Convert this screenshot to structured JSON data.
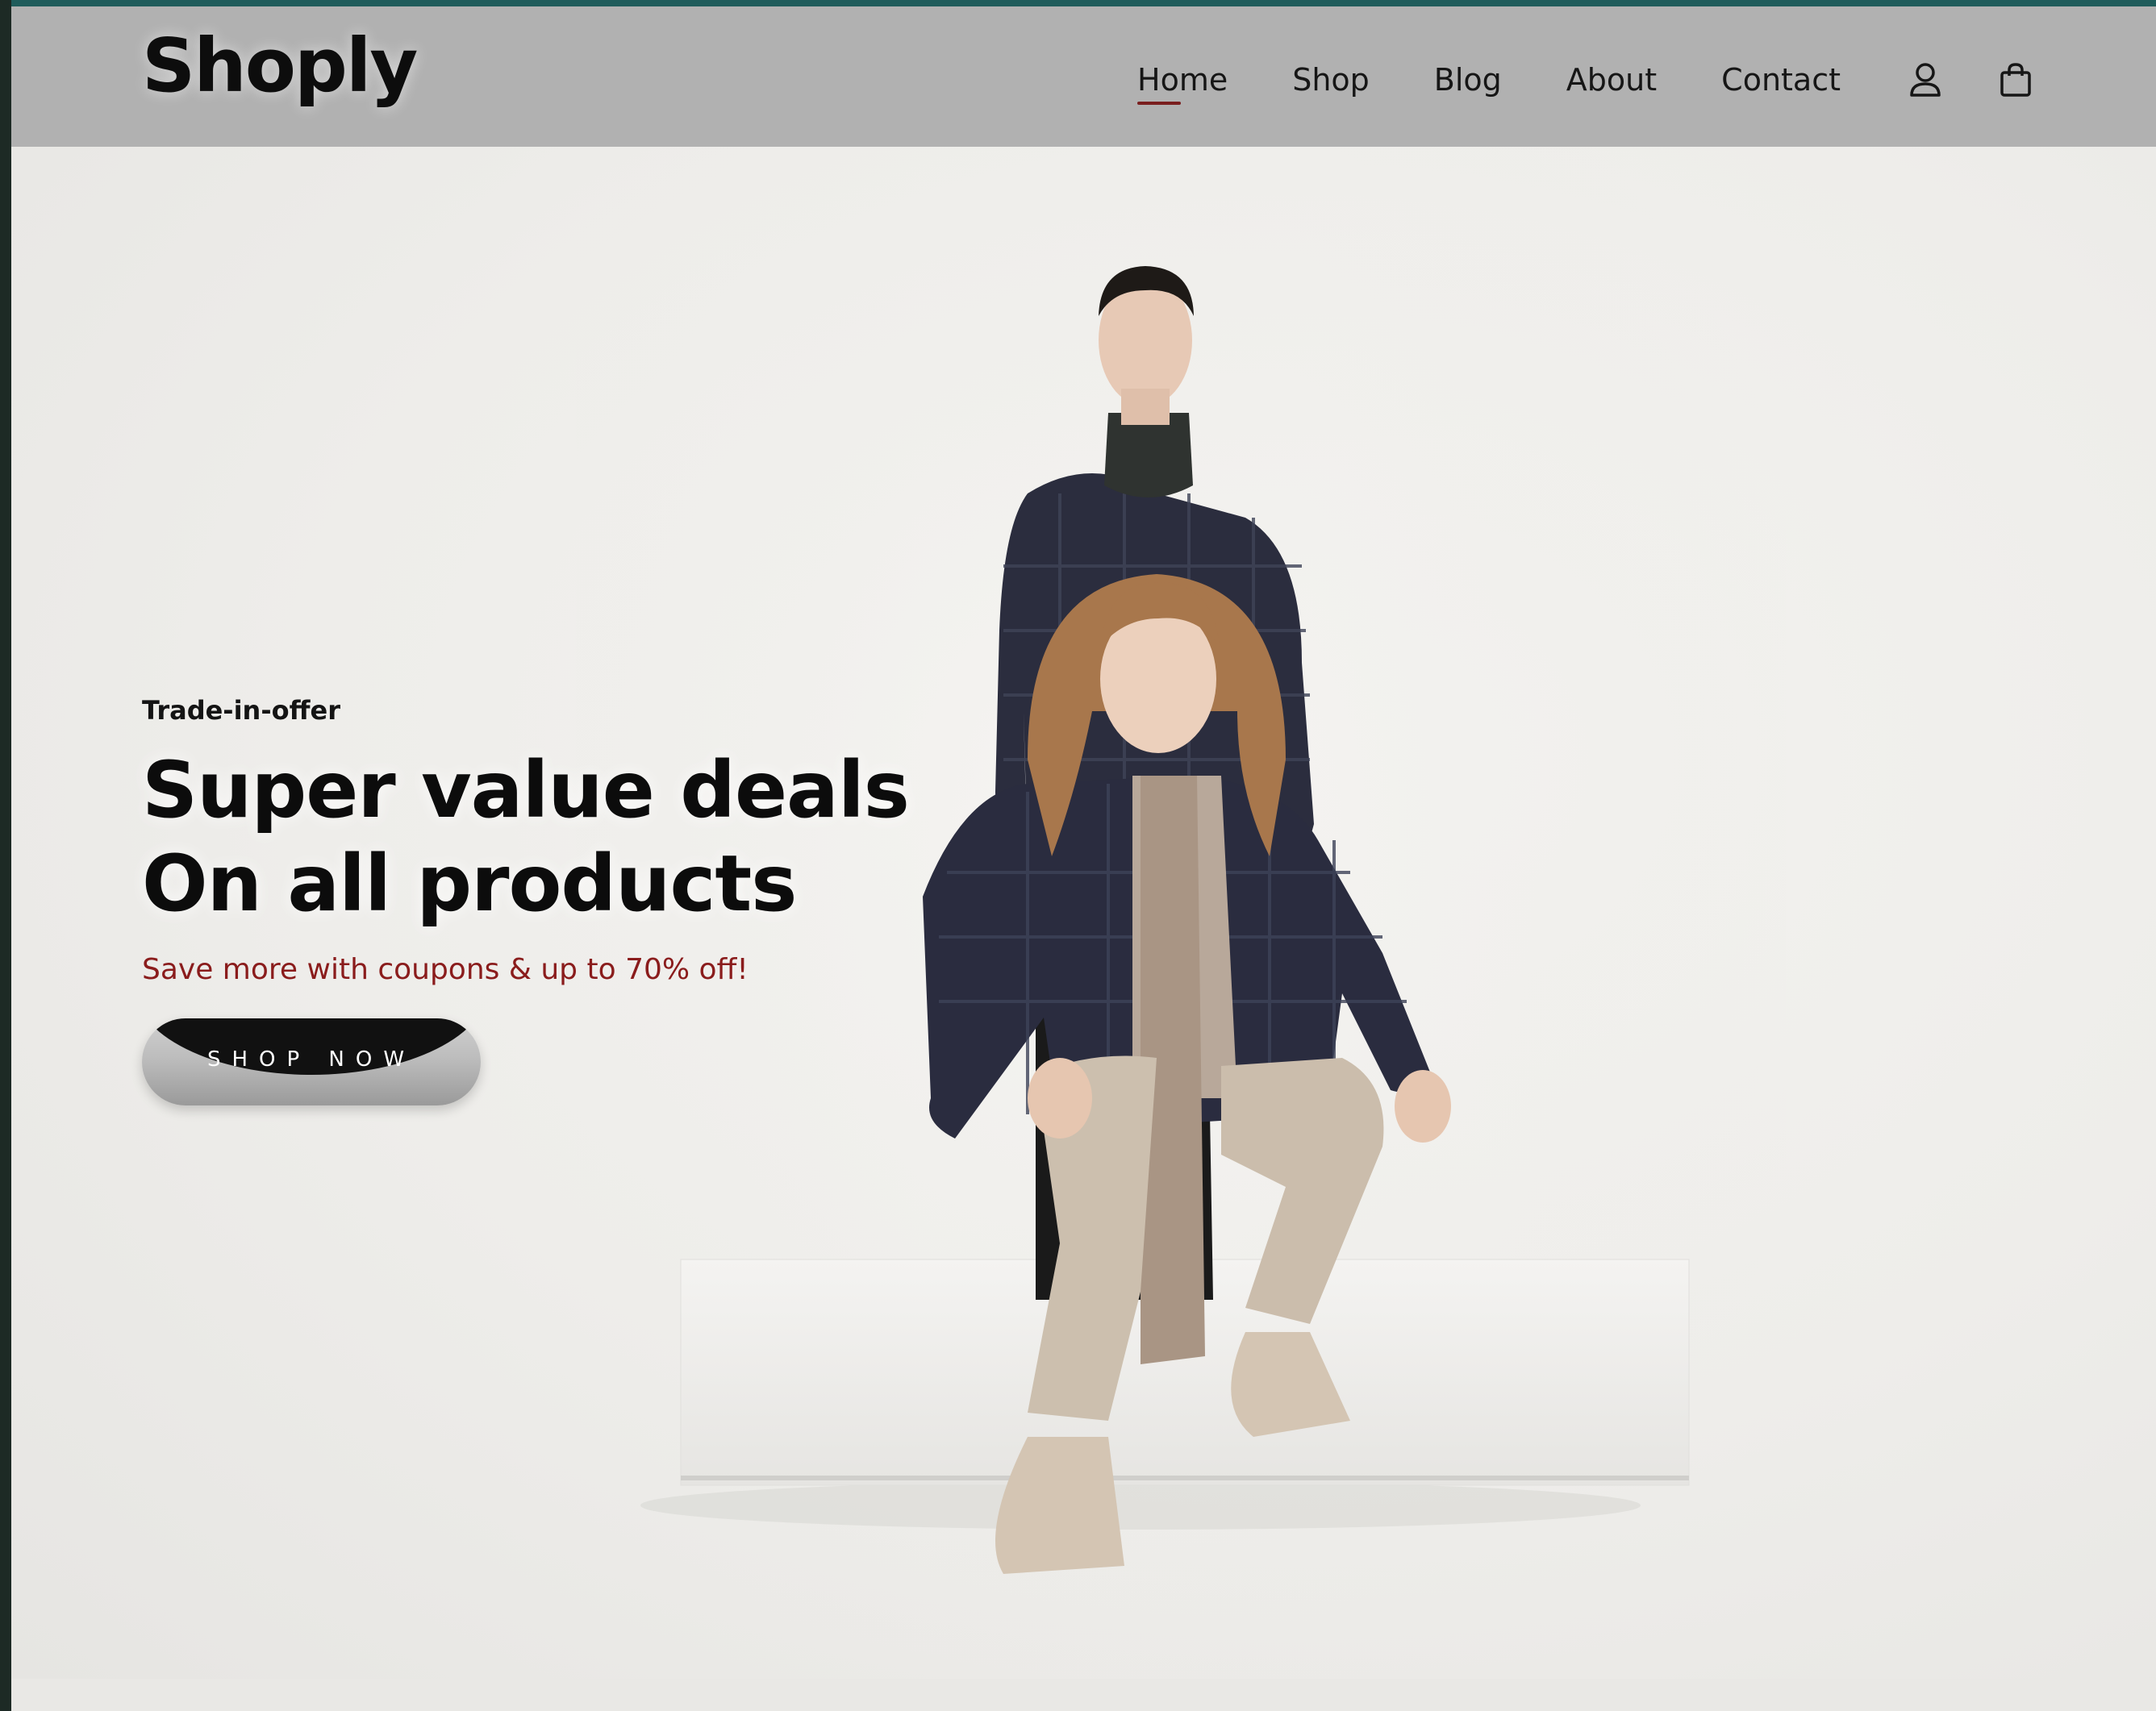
{
  "header": {
    "logo": "Shoply",
    "nav": [
      {
        "label": "Home",
        "active": true
      },
      {
        "label": "Shop",
        "active": false
      },
      {
        "label": "Blog",
        "active": false
      },
      {
        "label": "About",
        "active": false
      },
      {
        "label": "Contact",
        "active": false
      }
    ],
    "icons": [
      "user-icon",
      "shopping-bag-icon"
    ]
  },
  "hero": {
    "eyebrow": "Trade-in-offer",
    "headline_line1": "Super value deals",
    "headline_line2": "On all products",
    "subline": "Save more with coupons & up to 70% off!",
    "cta_label": "SHOP NOW",
    "image": "hero-models-photo"
  },
  "colors": {
    "header_bg": "#b1b1b1",
    "accent_top": "#1f5c5b",
    "nav_underline": "#7a1f1f",
    "subline": "#8a1c1c",
    "hero_bg": "#f0efec"
  }
}
